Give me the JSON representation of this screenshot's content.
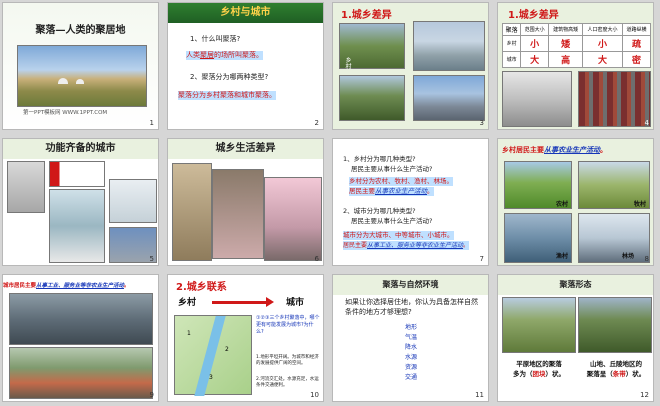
{
  "slides": [
    {
      "n": "1",
      "title": "聚落—人类的聚居地",
      "footer": "第一PPT模板网 WWW.1PPT.COM"
    },
    {
      "n": "2",
      "title": "乡村与城市",
      "q1": "1、什么叫聚落?",
      "a1_prefix": "人类",
      "a1_mid": "聚居",
      "a1_suffix": "的场所叫聚落。",
      "q2": "2、聚落分为哪两种类型?",
      "a2": "聚落分为乡村聚落和城市聚落。"
    },
    {
      "n": "3",
      "title": "1.城乡差异",
      "label": "乡村"
    },
    {
      "n": "4",
      "title": "1.城乡差异",
      "table": {
        "headers": [
          "聚落",
          "范围大小",
          "建筑物高矮",
          "人口密度大小",
          "道路纵横"
        ],
        "rows": [
          [
            "乡村",
            "小",
            "矮",
            "小",
            "疏"
          ],
          [
            "城市",
            "大",
            "高",
            "大",
            "密"
          ]
        ]
      }
    },
    {
      "n": "5",
      "title": "功能齐备的城市"
    },
    {
      "n": "6",
      "title": "城乡生活差异"
    },
    {
      "n": "7",
      "q1": "1、乡村分为哪几种类型?",
      "q1b": "居民主要从事什么生产活动?",
      "a1": "乡村分为农村、牧村、渔村、林场。",
      "a1b_prefix": "居民主要",
      "a1b_em": "从事农业生产活动",
      "a1b_suffix": "。",
      "q2": "2、城市分为哪几种类型?",
      "q2b": "居民主要从事什么生产活动?",
      "a2": "城市分为大城市、中等城市、小城市。",
      "a2b_prefix": "居民主要",
      "a2b_em": "从事工业、服务业等非农业生产活动",
      "a2b_suffix": "。"
    },
    {
      "n": "8",
      "title_prefix": "乡村居民主要",
      "title_em": "从事农业生产活动",
      "title_suffix": "。",
      "labels": [
        "农村",
        "牧村",
        "渔村",
        "林场"
      ]
    },
    {
      "n": "9",
      "title_prefix": "城市居民主要",
      "title_em": "从事工业、服务业等非农业生产活动",
      "title_suffix": "。"
    },
    {
      "n": "10",
      "title": "2.城乡联系",
      "left": "乡村",
      "right": "城市",
      "map_q": "①②③三个乡村聚落中，哪个更有可能发展为城市?为什么?",
      "map_a1": "1.地形平坦开阔。为城市和经济的发展提供广阔的空间。",
      "map_a2": "2.河流交汇处。水源充足，水运条件交通便利。"
    },
    {
      "n": "11",
      "title": "聚落与自然环境",
      "q": "如果让你选择居住地，你认为具备怎样自然条件的地方才够理想?",
      "items": [
        "地形",
        "气温",
        "降水",
        "水源",
        "资源",
        "交通"
      ]
    },
    {
      "n": "12",
      "title": "聚落形态",
      "left_cap_a": "平原地区的聚落",
      "left_cap_b": "多为（",
      "left_cap_c": "团块",
      "left_cap_d": "）状。",
      "right_cap_a": "山地、丘陵地区的",
      "right_cap_b": "聚落呈（",
      "right_cap_c": "条带",
      "right_cap_d": "）状。"
    }
  ],
  "colors": {
    "header_green": "#2f7f2f",
    "title_red": "#d01818",
    "emphasis_blue": "#1636b8",
    "highlight": "#bfe0ff"
  }
}
